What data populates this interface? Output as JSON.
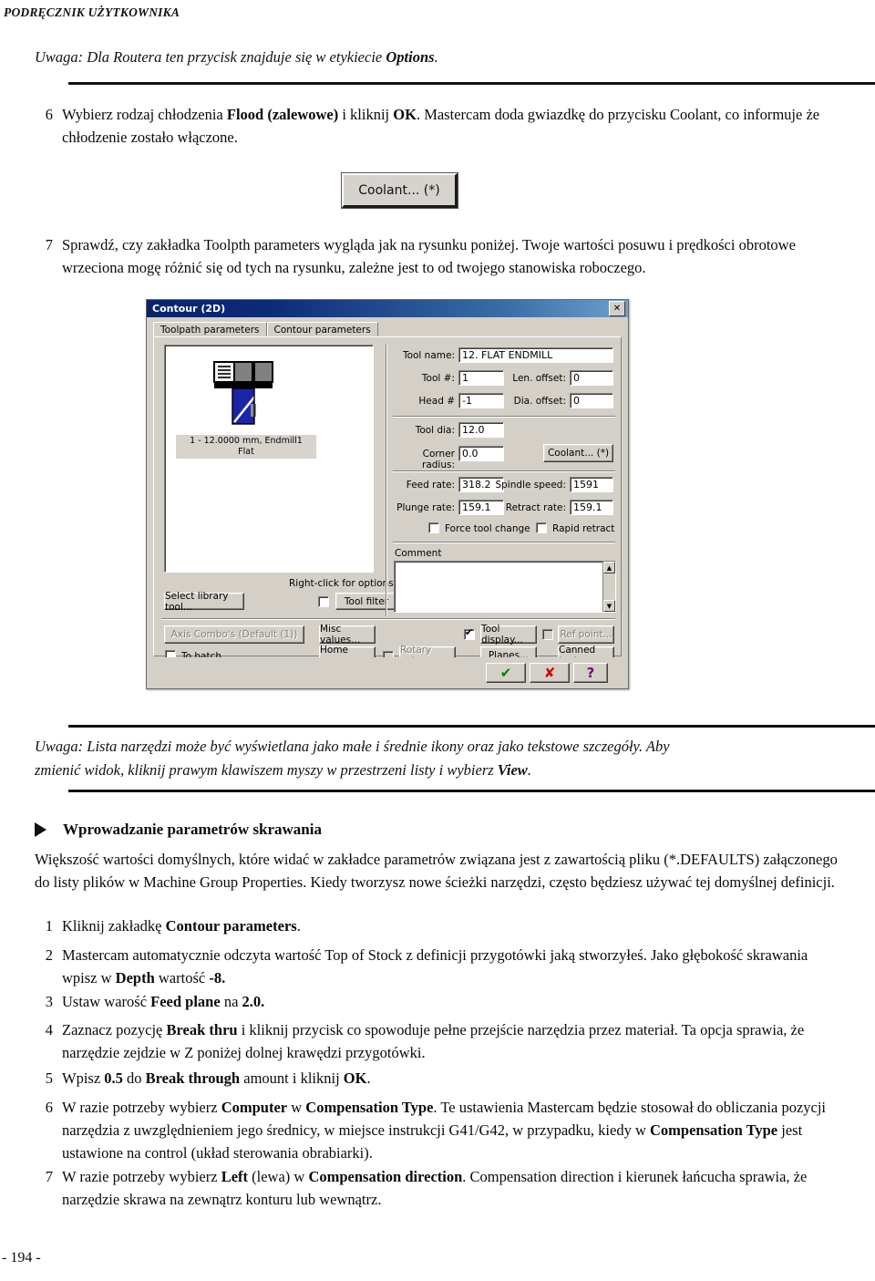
{
  "page": {
    "running_header": "PODRĘCZNIK UŻYTKOWNIKA",
    "folio": "- 194 -"
  },
  "note_top": {
    "prefix": "Uwaga: Dla Routera ten przycisk znajduje się w etykiecie ",
    "bold": "Options",
    "suffix": "."
  },
  "note_bottom": {
    "line1": "Uwaga: Lista narzędzi może być wyświetlana jako małe i średnie ikony oraz jako tekstowe szczegóły. Aby",
    "line2_prefix": "zmienić widok,  kliknij prawym klawiszem myszy w przestrzeni listy i wybierz ",
    "line2_bold": "View",
    "line2_suffix": "."
  },
  "steps_upper": [
    {
      "num": "6",
      "p1": "Wybierz rodzaj chłodzenia ",
      "b1": "Flood (zalewowe)",
      "p2": " i kliknij ",
      "b2": "OK",
      "p3": ". Mastercam doda gwiazdkę do przycisku Coolant, co informuje że chłodzenie zostało włączone."
    },
    {
      "num": "7",
      "p1": "Sprawdź, czy zakładka Toolpth parameters wygląda jak na rysunku poniżej. Twoje wartości posuwu i prędkości obrotowe wrzeciona mogę różnić się od tych na rysunku, zależne jest to od twojego stanowiska roboczego.",
      "b1": "",
      "p2": "",
      "b2": "",
      "p3": ""
    }
  ],
  "coolant_figure": {
    "label": "Coolant... (*)"
  },
  "section": {
    "heading": "Wprowadzanie parametrów skrawania",
    "paragraph": "Większość wartości domyślnych, które widać w zakładce parametrów związana jest z zawartością pliku (*.DEFAULTS) załączonego do listy plików w Machine Group Properties. Kiedy tworzysz nowe ścieżki narzędzi, często będziesz używać tej domyślnej definicji."
  },
  "steps_lower": [
    {
      "num": "1",
      "parts": [
        {
          "t": "Kliknij zakładkę ",
          "b": false
        },
        {
          "t": "Contour parameters",
          "b": true
        },
        {
          "t": ".",
          "b": false
        }
      ]
    },
    {
      "num": "2",
      "parts": [
        {
          "t": "Mastercam automatycznie odczyta wartość Top of Stock z definicji przygotówki jaką stworzyłeś. Jako głębokość skrawania wpisz w ",
          "b": false
        },
        {
          "t": "Depth",
          "b": true
        },
        {
          "t": " wartość ",
          "b": false
        },
        {
          "t": "-8.",
          "b": true
        }
      ]
    },
    {
      "num": "3",
      "parts": [
        {
          "t": "Ustaw warość ",
          "b": false
        },
        {
          "t": "Feed plane",
          "b": true
        },
        {
          "t": " na ",
          "b": false
        },
        {
          "t": "2.0.",
          "b": true
        }
      ]
    },
    {
      "num": "4",
      "parts": [
        {
          "t": "Zaznacz pozycję ",
          "b": false
        },
        {
          "t": "Break thru",
          "b": true
        },
        {
          "t": " i kliknij przycisk co spowoduje pełne przejście narzędzia przez materiał. Ta opcja sprawia, że narzędzie zejdzie w Z poniżej dolnej krawędzi przygotówki.",
          "b": false
        }
      ]
    },
    {
      "num": "5",
      "parts": [
        {
          "t": "Wpisz ",
          "b": false
        },
        {
          "t": "0.5",
          "b": true
        },
        {
          "t": " do ",
          "b": false
        },
        {
          "t": "Break through",
          "b": true
        },
        {
          "t": " amount i kliknij ",
          "b": false
        },
        {
          "t": "OK",
          "b": true
        },
        {
          "t": ".",
          "b": false
        }
      ]
    },
    {
      "num": "6",
      "parts": [
        {
          "t": "W razie potrzeby wybierz ",
          "b": false
        },
        {
          "t": "Computer",
          "b": true
        },
        {
          "t": " w ",
          "b": false
        },
        {
          "t": "Compensation Type",
          "b": true
        },
        {
          "t": ". Te ustawienia Mastercam będzie stosował do obliczania pozycji narzędzia z uwzględnieniem jego średnicy, w miejsce instrukcji G41/G42, w przypadku, kiedy w ",
          "b": false
        },
        {
          "t": "Compensation Type",
          "b": true
        },
        {
          "t": " jest ustawione na control (układ sterowania obrabiarki).",
          "b": false
        }
      ]
    },
    {
      "num": "7",
      "parts": [
        {
          "t": "W razie potrzeby wybierz ",
          "b": false
        },
        {
          "t": "Left",
          "b": true
        },
        {
          "t": " (lewa) w ",
          "b": false
        },
        {
          "t": "Compensation direction",
          "b": true
        },
        {
          "t": ". Compensation direction i kierunek łańcucha sprawia, że narzędzie skrawa na zewnątrz konturu lub wewnątrz.",
          "b": false
        }
      ]
    }
  ],
  "dialog": {
    "title": "Contour (2D)",
    "close_label": "✕",
    "tabs": [
      {
        "label": "Toolpath parameters",
        "active": true
      },
      {
        "label": "Contour parameters",
        "active": false
      }
    ],
    "tool_list": {
      "caption_line1": "1 - 12.0000 mm, Endmill1",
      "caption_line2": "Flat"
    },
    "right_click_hint": "Right-click for options",
    "fields": {
      "tool_name_label": "Tool name:",
      "tool_name_value": "12. FLAT ENDMILL",
      "tool_num_label": "Tool #:",
      "tool_num_value": "1",
      "len_offset_label": "Len. offset:",
      "len_offset_value": "0",
      "head_num_label": "Head #",
      "head_num_value": "-1",
      "dia_offset_label": "Dia. offset:",
      "dia_offset_value": "0",
      "tool_dia_label": "Tool dia:",
      "tool_dia_value": "12.0",
      "corner_radius_label": "Corner radius:",
      "corner_radius_value": "0.0",
      "feed_rate_label": "Feed rate:",
      "feed_rate_value": "318.2",
      "spindle_speed_label": "Spindle speed:",
      "spindle_speed_value": "1591",
      "plunge_rate_label": "Plunge rate:",
      "plunge_rate_value": "159.1",
      "retract_rate_label": "Retract rate:",
      "retract_rate_value": "159.1",
      "comment_label": "Comment",
      "comment_value": ""
    },
    "checkboxes": {
      "force_tool_change": "Force tool change",
      "rapid_retract": "Rapid retract",
      "tool_filter": "",
      "to_batch": "To batch",
      "rotary_axis": "",
      "tool_display": "",
      "ref_point": ""
    },
    "buttons": {
      "coolant": "Coolant... (*)",
      "select_library_tool": "Select library tool...",
      "tool_filter": "Tool filter",
      "axis_combos": "Axis Combo's (Default (1))",
      "misc_values": "Misc values...",
      "home_pos": "Home pos...",
      "rotary_axis": "Rotary axis...",
      "tool_display": "Tool display...",
      "ref_point": "Ref point...",
      "planes": "Planes...",
      "canned_text": "Canned text...",
      "ok": "✔",
      "cancel": "✘",
      "help": "?"
    },
    "scroll": {
      "up": "▲",
      "down": "▼"
    },
    "colors": {
      "titlebar_start": "#0a246a",
      "titlebar_end": "#6f9fd0",
      "face": "#d4d0c8",
      "ok_green": "#008000",
      "cancel_red": "#d00000",
      "help_purple": "#800080",
      "tool_blue": "#1c24a8"
    }
  }
}
